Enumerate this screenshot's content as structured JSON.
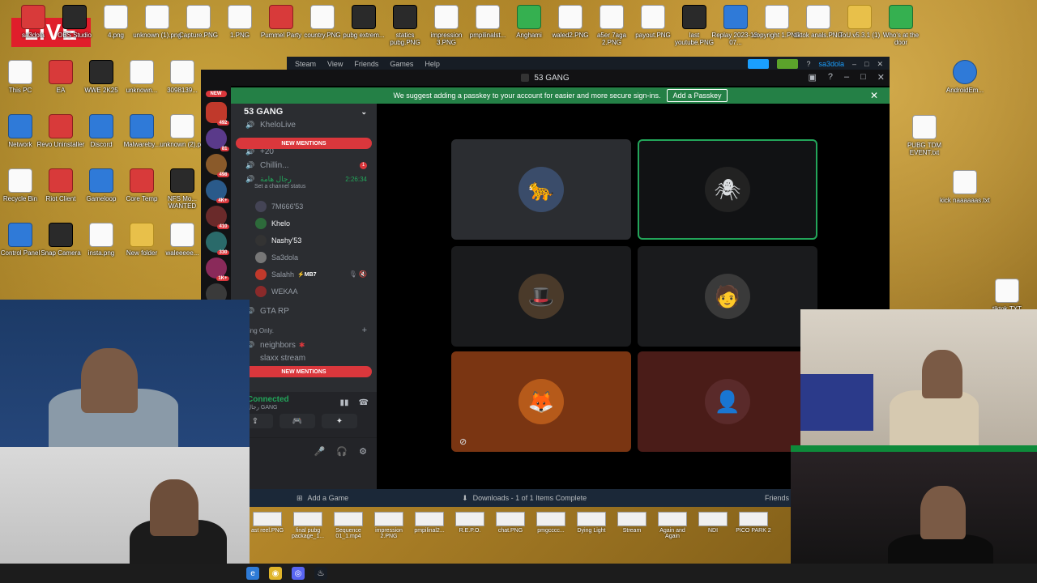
{
  "live_badge": "LIVE",
  "desktop_icons_top": [
    "sa3dola",
    "OBS Studio",
    "4.png",
    "unknown (1).png",
    "Capture.PNG",
    "1.PNG",
    "Pummel Party",
    "country.PNG",
    "pubg extrem...",
    "statics pubg.PNG",
    "impression 3.PNG",
    "pmpilinalst...",
    "Anghami",
    "waled2.PNG",
    "a5er 7aga 2.PNG",
    "payout.PNG",
    "last youtube.PNG",
    "Replay 2023-12-07...",
    "copyright 1.PNG",
    "tiktok anals.PNG",
    "ToU.v5.3.1 (1)",
    "Who's at the door"
  ],
  "desktop_icons_left": [
    "This PC",
    "EA",
    "WWE 2K25",
    "unknown...",
    "3098139...",
    "Network",
    "Revo Uninstaller",
    "Discord",
    "Malwareby...",
    "unknown (2).pn",
    "Recycle Bin",
    "Riot Client",
    "Gameloop",
    "Core Temp",
    "NFS Mo... WANTED",
    "Control Panel",
    "Snap Camera",
    "insta.png",
    "New folder",
    "waleeeee..."
  ],
  "desktop_icons_right": [
    "AndroidEm...",
    "PUBG TDM EVENT.txt",
    "kick naaaaaas.txt",
    "tiktok.TXT"
  ],
  "steam": {
    "menu": [
      "Steam",
      "View",
      "Friends",
      "Games",
      "Help"
    ],
    "user": "sa3dola",
    "footer_add_game": "Add a Game",
    "footer_downloads": "Downloads - 1 of 1 Items Complete",
    "footer_friends": "Friends"
  },
  "discord": {
    "window_title": "53 GANG",
    "banner_text": "We suggest adding a passkey to your account for easier and more secure sign-ins.",
    "banner_button": "Add a Passkey",
    "server_name": "53 GANG",
    "new_mentions": "NEW MENTIONS",
    "guild_new": "NEW",
    "guild_counts": [
      "492",
      "81",
      "498",
      "4K+",
      "410",
      "330",
      "1K+"
    ],
    "channels_top": [
      {
        "name": "KheloLive",
        "icon": "speaker-icon"
      },
      {
        "name": "+20",
        "icon": "speaker-icon"
      },
      {
        "name": "Chillin...",
        "icon": "speaker-icon",
        "badge": "1"
      }
    ],
    "active_channel": {
      "name": "رجال هامة",
      "timer": "2:26:34",
      "status": "Set a channel status"
    },
    "members": [
      {
        "name": "7M666'53",
        "bright": false,
        "tag": ""
      },
      {
        "name": "Khelo",
        "bright": true,
        "tag": ""
      },
      {
        "name": "Nashy'53",
        "bright": true,
        "tag": ""
      },
      {
        "name": "Sa3dola",
        "bright": false,
        "tag": ""
      },
      {
        "name": "Salahh",
        "bright": false,
        "tag": "⚡MB7"
      },
      {
        "name": "WEKAA",
        "bright": false,
        "tag": ""
      }
    ],
    "channel_gta": "GTA RP",
    "category_only": "ing Only.",
    "channel_neighbors": "neighbors",
    "channel_slaxx": "slaxx stream",
    "voice_status": "Connected",
    "voice_channel": "رجال GANG"
  },
  "colors": {
    "discord_green": "#23a55a",
    "mention_red": "#da373c",
    "banner_green": "#248046"
  },
  "tiles": [
    {
      "name": "tile-panther",
      "bg": "#2b2d31",
      "pfp": "#3a4c6a",
      "glyph": "🐆",
      "speaking": false
    },
    {
      "name": "tile-venom",
      "bg": "#111214",
      "pfp": "#222",
      "glyph": "🕷",
      "speaking": true
    },
    {
      "name": "tile-shelby",
      "bg": "#1a1b1d",
      "pfp": "#4a3a2a",
      "glyph": "🎩",
      "speaking": false
    },
    {
      "name": "tile-hood",
      "bg": "#1a1b1d",
      "pfp": "#3a3a3a",
      "glyph": "🧑",
      "speaking": false
    },
    {
      "name": "tile-orange",
      "bg": "#7a3512",
      "pfp": "#b65a1a",
      "glyph": "🦊",
      "speaking": false
    },
    {
      "name": "tile-wekaa",
      "bg": "#4a1c18",
      "pfp": "#5a2a2a",
      "glyph": "👤",
      "speaking": false
    }
  ],
  "taskbar_files": [
    "ast reel.PNG",
    "final pubg package_1...",
    "Sequence 01_1.mp4",
    "impression 2.PNG",
    "pmpilinal2...",
    "R.E.P.O.",
    "chat.PNG",
    "pmgcccc...",
    "Dying Light",
    "Stream",
    "Again and Again",
    "NDI",
    "PICO PARK 2"
  ]
}
